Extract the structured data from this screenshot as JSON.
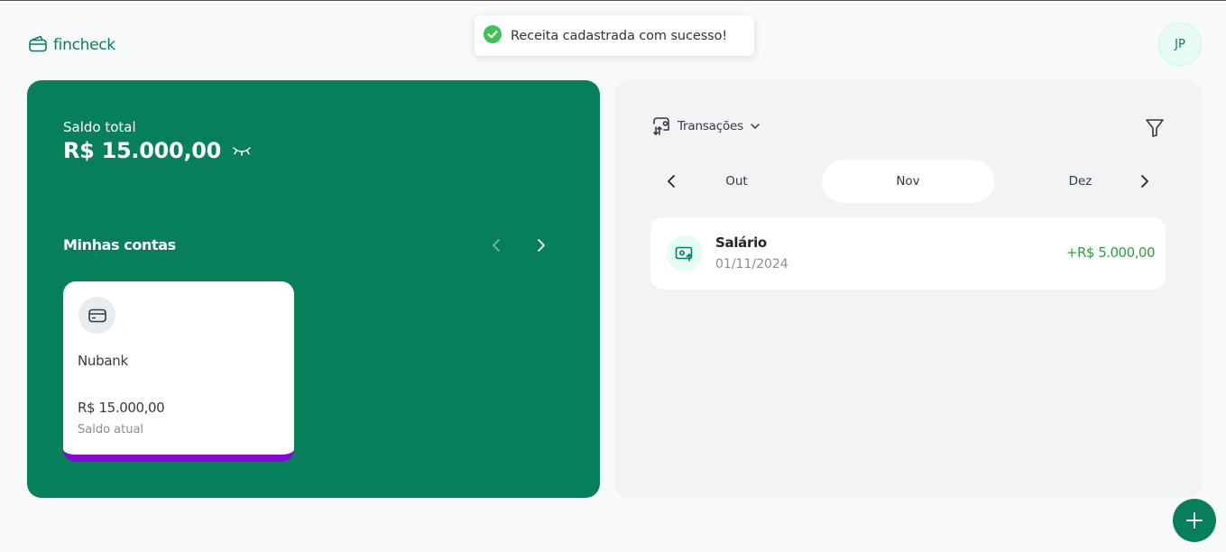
{
  "app": {
    "name": "fincheck",
    "user_initials": "JP"
  },
  "toast": {
    "message": "Receita cadastrada com sucesso!",
    "status_color": "#40c057"
  },
  "colors": {
    "brand": "#087f5b",
    "income": "#2f9e44",
    "account_nubank": "#820ad1"
  },
  "balance": {
    "label": "Saldo total",
    "value": "R$ 15.000,00",
    "toggle_icon": "eye-closed-icon"
  },
  "accounts": {
    "title": "Minhas contas",
    "items": [
      {
        "name": "Nubank",
        "balance": "R$ 15.000,00",
        "balance_label": "Saldo atual",
        "icon": "credit-card-icon",
        "color": "#820ad1"
      }
    ]
  },
  "transactions": {
    "filter_label": "Transações",
    "months": [
      {
        "label": "Out",
        "active": false
      },
      {
        "label": "Nov",
        "active": true
      },
      {
        "label": "Dez",
        "active": false
      }
    ],
    "items": [
      {
        "title": "Salário",
        "date": "01/11/2024",
        "value": "+R$ 5.000,00",
        "type": "income",
        "icon": "income-icon"
      }
    ]
  }
}
